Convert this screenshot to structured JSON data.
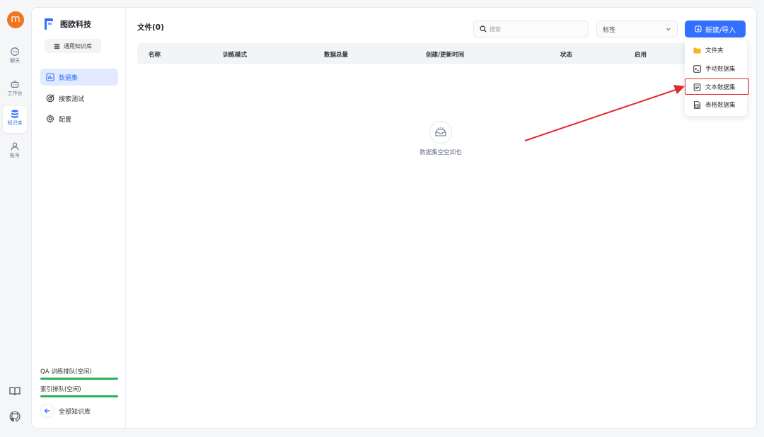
{
  "user": {
    "avatar_letter": "m"
  },
  "rail": {
    "items": [
      {
        "label": "聊天",
        "icon": "chat-icon"
      },
      {
        "label": "工作台",
        "icon": "robot-icon"
      },
      {
        "label": "知识库",
        "icon": "database-icon",
        "active": true
      },
      {
        "label": "账号",
        "icon": "user-icon"
      }
    ],
    "bottom_icons": [
      "book-icon",
      "github-icon"
    ]
  },
  "brand": {
    "name": "图欧科技"
  },
  "panel": {
    "kb_type": "通用知识库",
    "nav": [
      {
        "label": "数据集",
        "icon": "chart-icon",
        "active": true
      },
      {
        "label": "搜索测试",
        "icon": "target-icon"
      },
      {
        "label": "配置",
        "icon": "gear-icon"
      }
    ],
    "queues": [
      {
        "label": "QA 训练排队(空闲)"
      },
      {
        "label": "索引排队(空闲)"
      }
    ],
    "back_label": "全部知识库"
  },
  "content": {
    "title": "文件(0)",
    "search_placeholder": "搜索",
    "tag_select": "标签",
    "new_button": "新建/导入",
    "table_headers": [
      "名称",
      "训练模式",
      "数据总量",
      "创建/更新时间",
      "状态",
      "启用"
    ],
    "empty_text": "数据集空空如也"
  },
  "menu": {
    "items": [
      {
        "label": "文件夹",
        "icon": "folder-icon"
      },
      {
        "label": "手动数据集",
        "icon": "terminal-icon"
      },
      {
        "label": "文本数据集",
        "icon": "document-icon",
        "highlighted": true
      },
      {
        "label": "表格数据集",
        "icon": "table-file-icon"
      }
    ]
  },
  "colors": {
    "accent": "#3370ff",
    "annotation": "#e0282e",
    "avatar": "#f0751e",
    "queue_bar": "#22b45c"
  }
}
